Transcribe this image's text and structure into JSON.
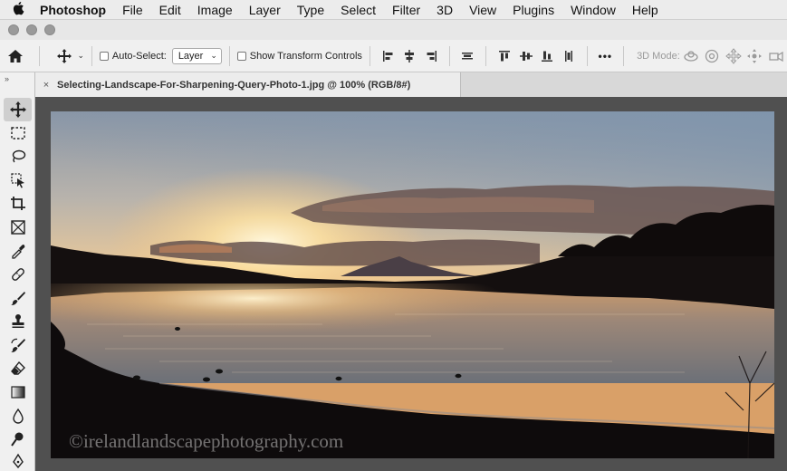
{
  "menubar": {
    "app_name": "Photoshop",
    "items": [
      "File",
      "Edit",
      "Image",
      "Layer",
      "Type",
      "Select",
      "Filter",
      "3D",
      "View",
      "Plugins",
      "Window",
      "Help"
    ]
  },
  "options": {
    "auto_select_label": "Auto-Select:",
    "layer_select_value": "Layer",
    "show_transform_label": "Show Transform Controls",
    "more": "•••",
    "mode_3d_label": "3D Mode:"
  },
  "document": {
    "close_glyph": "×",
    "tab_title": "Selecting-Landscape-For-Sharpening-Query-Photo-1.jpg @ 100% (RGB/8#)"
  },
  "photo": {
    "watermark": "©irelandlandscapephotography.com"
  },
  "colors": {
    "menubar_bg": "#ececec",
    "panel_bg": "#f0f0f0",
    "canvas_bg": "#505050"
  }
}
